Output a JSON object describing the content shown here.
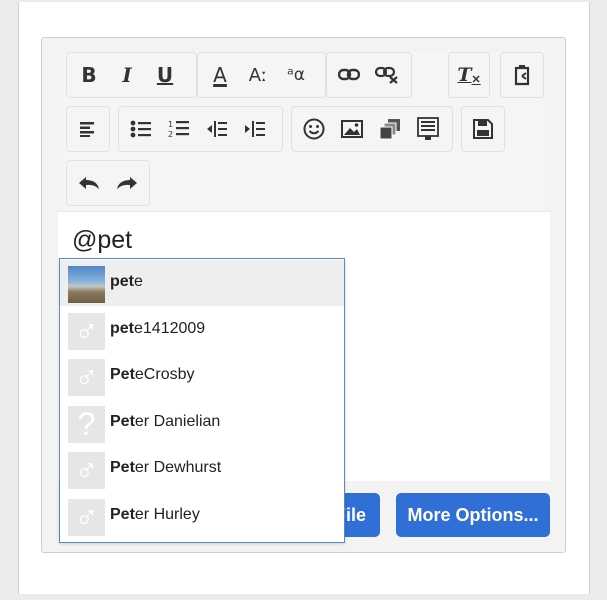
{
  "toolbar": {
    "buttons": {
      "bold": "B",
      "italic": "I",
      "underline": "U",
      "font_color": "A",
      "font_size": "Aː",
      "special_chars": "ᵃα",
      "clear_format": "T"
    }
  },
  "editor": {
    "text": "@pet"
  },
  "actions": {
    "file_label": "File",
    "more_options_label": "More Options..."
  },
  "mentions": [
    {
      "match": "pet",
      "rest": "e",
      "avatar": "photo"
    },
    {
      "match": "pet",
      "rest": "e1412009",
      "avatar": "male"
    },
    {
      "match": "Pet",
      "rest": "eCrosby",
      "avatar": "male"
    },
    {
      "match": "Pet",
      "rest": "er Danielian",
      "avatar": "unknown"
    },
    {
      "match": "Pet",
      "rest": "er Dewhurst",
      "avatar": "male"
    },
    {
      "match": "Pet",
      "rest": "er Hurley",
      "avatar": "male"
    }
  ],
  "colors": {
    "accent": "#2f6fd6",
    "dropdown_border": "#5b86c8"
  }
}
